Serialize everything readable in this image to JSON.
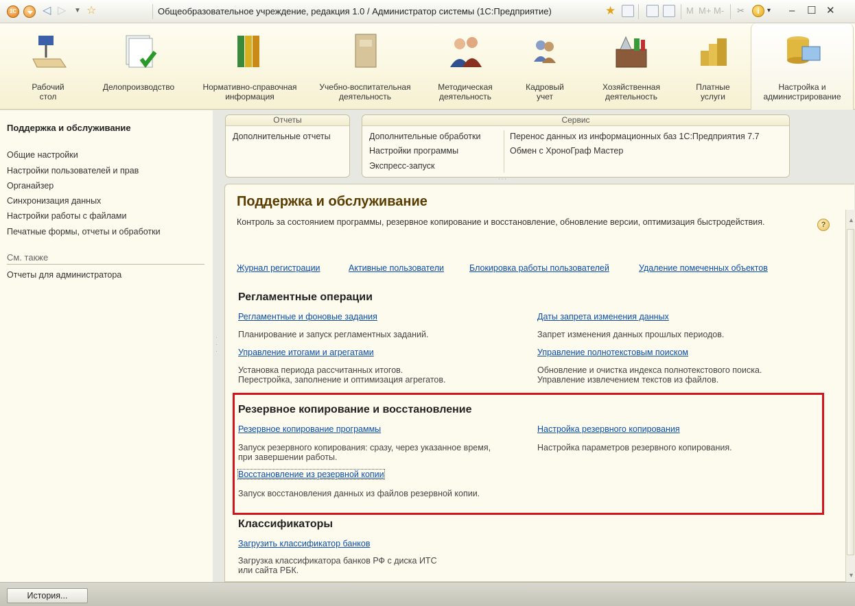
{
  "window": {
    "title": "Общеобразовательное учреждение, редакция 1.0 / Администратор системы  (1С:Предприятие)",
    "logo_text": "1С",
    "tool_m": "M",
    "tool_mplus": "M+",
    "tool_mminus": "M-"
  },
  "sections": [
    {
      "label": "Рабочий\nстол",
      "icon": "desk-lamp-icon"
    },
    {
      "label": "Делопроизводство",
      "icon": "documents-check-icon"
    },
    {
      "label": "Нормативно-справочная\nинформация",
      "icon": "binders-icon"
    },
    {
      "label": "Учебно-воспитательная\nдеятельность",
      "icon": "book-icon"
    },
    {
      "label": "Методическая\nдеятельность",
      "icon": "people-group-icon"
    },
    {
      "label": "Кадровый\nучет",
      "icon": "staff-icon"
    },
    {
      "label": "Хозяйственная\nдеятельность",
      "icon": "toolbox-icon"
    },
    {
      "label": "Платные\nуслуги",
      "icon": "coins-icon"
    },
    {
      "label": "Настройка и\nадминистрирование",
      "icon": "database-monitor-icon"
    }
  ],
  "leftnav": {
    "heading": "Поддержка и обслуживание",
    "items": [
      "Общие настройки",
      "Настройки пользователей и прав",
      "Органайзер",
      "Синхронизация данных",
      "Настройки работы с файлами",
      "Печатные формы, отчеты и обработки"
    ],
    "see_also": "См. также",
    "see_also_items": [
      "Отчеты для администратора"
    ]
  },
  "commandbar": {
    "reports_title": "Отчеты",
    "reports_items": [
      "Дополнительные отчеты"
    ],
    "service_title": "Сервис",
    "service_col1": [
      "Дополнительные обработки",
      "Настройки программы",
      "Экспресс-запуск"
    ],
    "service_col2": [
      "Перенос данных из информационных баз 1С:Предприятия 7.7",
      "Обмен с ХроноГраф Мастер"
    ]
  },
  "content": {
    "title": "Поддержка и обслуживание",
    "description": "Контроль за состоянием программы, резервное копирование и восстановление, обновление версии, оптимизация быстродействия.",
    "top_links": [
      "Журнал регистрации",
      "Активные пользователи",
      "Блокировка работы пользователей",
      "Удаление помеченных объектов"
    ],
    "routine": {
      "heading": "Регламентные операции",
      "link1": "Регламентные и фоновые задания",
      "desc1": "Планирование и запуск регламентных заданий.",
      "link2": "Даты запрета изменения данных",
      "desc2": "Запрет изменения данных прошлых периодов.",
      "link3": "Управление итогами и агрегатами",
      "desc3a": "Установка периода рассчитанных итогов.",
      "desc3b": "Перестройка, заполнение и оптимизация агрегатов.",
      "link4": "Управление полнотекстовым поиском",
      "desc4a": "Обновление и очистка индекса полнотекстового поиска.",
      "desc4b": "Управление извлечением текстов из файлов."
    },
    "backup": {
      "heading": "Резервное копирование и восстановление",
      "link1": "Резервное копирование программы",
      "desc1a": "Запуск резервного копирования: сразу, через указанное время,",
      "desc1b": "при завершении работы.",
      "link2": "Настройка резервного копирования",
      "desc2": "Настройка параметров резервного копирования.",
      "link3": "Восстановление из резервной копии",
      "desc3": "Запуск восстановления данных из файлов резервной копии."
    },
    "classifiers": {
      "heading": "Классификаторы",
      "link1": "Загрузить классификатор банков",
      "desc1a": "Загрузка классификатора банков РФ с диска ИТС",
      "desc1b": "или сайта РБК."
    }
  },
  "statusbar": {
    "history_button": "История..."
  },
  "colors": {
    "accent_title": "#5a3c00",
    "link": "#0a4dad",
    "highlight_frame": "#d4141c"
  }
}
